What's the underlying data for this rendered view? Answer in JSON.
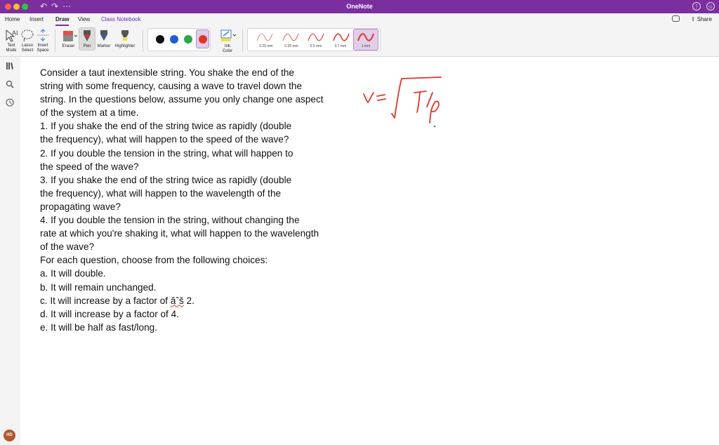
{
  "window": {
    "title": "OneNote"
  },
  "tabs": [
    {
      "label": "Home"
    },
    {
      "label": "Insert"
    },
    {
      "label": "Draw"
    },
    {
      "label": "View"
    },
    {
      "label": "Class Notebook"
    }
  ],
  "active_tab": "Draw",
  "share_label": "Share",
  "toolbar": {
    "text_mode": [
      "Text",
      "Mode"
    ],
    "lasso_select": [
      "Lasso",
      "Select"
    ],
    "insert_space": [
      "Insert",
      "Space"
    ],
    "eraser": "Eraser",
    "pen": "Pen",
    "marker": "Marker",
    "highlighter": "Highlighter",
    "ink_color": [
      "Ink",
      "Color"
    ],
    "pen_colors": [
      "#111111",
      "#1f5fd6",
      "#2aa84a",
      "#e0352b"
    ],
    "selected_pen_color": "#e0352b",
    "stroke_sizes": [
      "0.25 mm",
      "0.35 mm",
      "0.5 mm",
      "0.7 mm",
      "1 mm"
    ],
    "selected_stroke": "1 mm"
  },
  "user": {
    "initials": "HD"
  },
  "note": {
    "lines": [
      "Consider a taut inextensible string. You shake the end of the",
      "string with some frequency, causing a wave to travel down the",
      "string. In the questions below, assume you only change one aspect",
      "of the system at a time.",
      "1. If you shake the end of the string twice as rapidly (double",
      "the frequency), what will happen to the speed of the wave?",
      "2. If you double the tension in the string, what will happen to",
      "the speed of the wave?",
      "3. If you shake the end of the string twice as rapidly (double",
      "the frequency), what will happen to the wavelength of the",
      "propagating wave?",
      "4. If you double the tension in the string, without changing the",
      "rate at which you're shaking it, what will happen to the wavelength",
      "of the wave?",
      "For each question, choose from the following choices:",
      "a. It will double.",
      "b. It will remain unchanged."
    ],
    "choice_c_prefix": "c. It will increase by a factor of ",
    "choice_c_garbled": "âˆš",
    "choice_c_suffix": " 2.",
    "choice_d": "d. It will increase by a factor of 4.",
    "choice_e": "e. It will be half as fast/long."
  },
  "ink_color": "#e0352b"
}
